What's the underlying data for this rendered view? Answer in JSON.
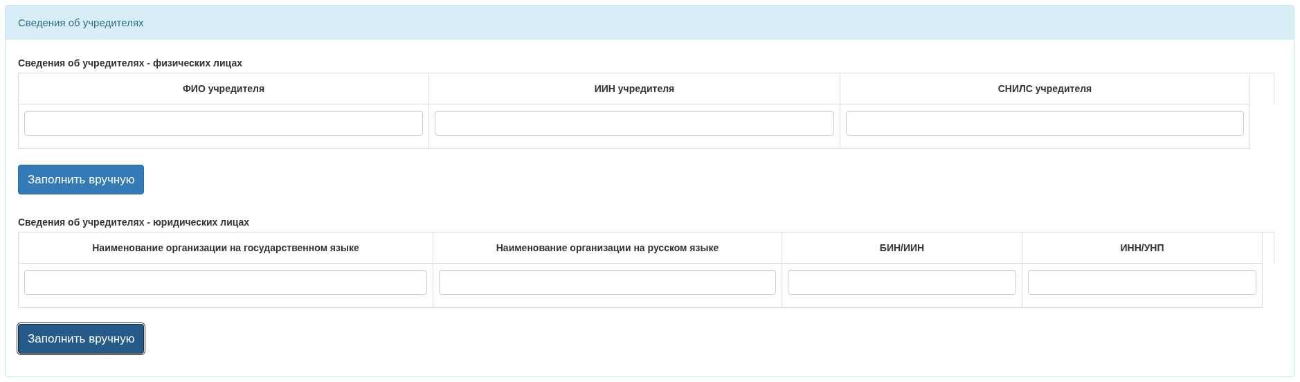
{
  "panel": {
    "title": "Сведения об учредителях"
  },
  "sections": [
    {
      "title": "Сведения об учредителях - физических лицах",
      "columns": [
        "ФИО учредителя",
        "ИИН учредителя",
        "СНИЛС учредителя"
      ],
      "button": {
        "label": "Заполнить вручную",
        "focused": false
      }
    },
    {
      "title": "Сведения об учредителях - юридических лицах",
      "columns": [
        "Наименование организации на государственном языке",
        "Наименование организации на русском языке",
        "БИН/ИИН",
        "ИНН/УНП"
      ],
      "button": {
        "label": "Заполнить вручную",
        "focused": true
      }
    }
  ]
}
